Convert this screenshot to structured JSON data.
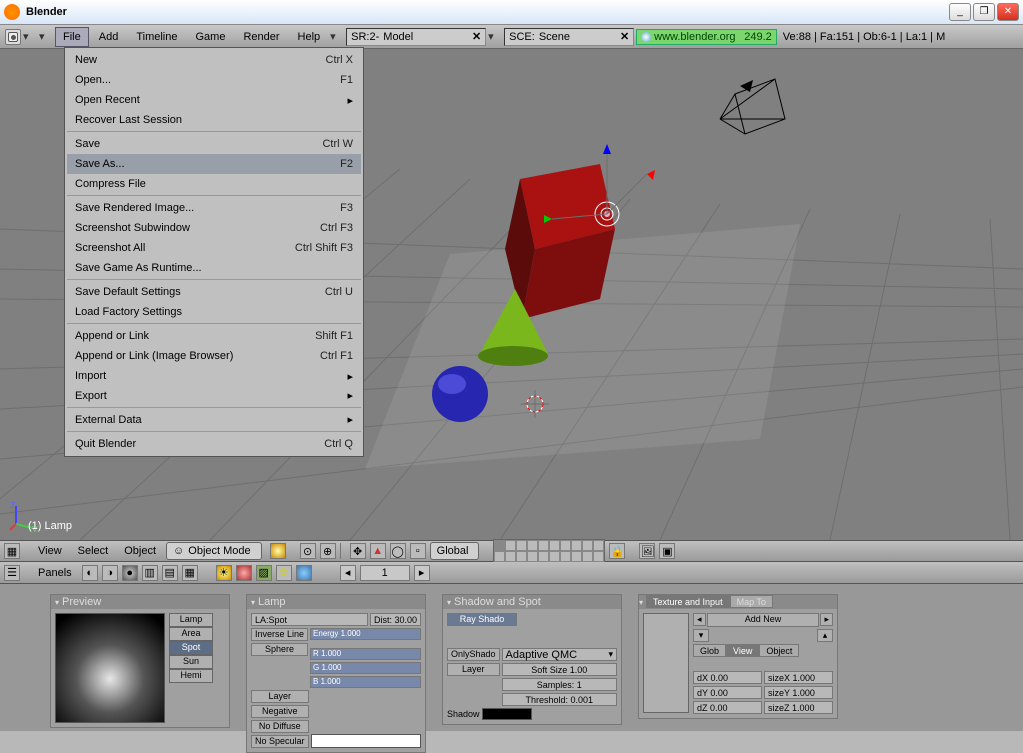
{
  "window": {
    "title": "Blender",
    "minimize": "_",
    "maximize": "❐",
    "close": "✕"
  },
  "topbar": {
    "menus": [
      "File",
      "Add",
      "Timeline",
      "Game",
      "Render",
      "Help"
    ],
    "sr_prefix": "SR:2-",
    "sr_value": "Model",
    "sce_prefix": "SCE:",
    "sce_value": "Scene",
    "url": "www.blender.org",
    "version": "249.2",
    "stats": "Ve:88 | Fa:151 | Ob:6-1 | La:1 | M"
  },
  "filemenu": [
    {
      "label": "New",
      "shortcut": "Ctrl X"
    },
    {
      "label": "Open...",
      "shortcut": "F1"
    },
    {
      "label": "Open Recent",
      "submenu": true
    },
    {
      "label": "Recover Last Session",
      "sep": true
    },
    {
      "label": "Save",
      "shortcut": "Ctrl W"
    },
    {
      "label": "Save As...",
      "shortcut": "F2",
      "hi": true
    },
    {
      "label": "Compress File",
      "sep": true
    },
    {
      "label": "Save Rendered Image...",
      "shortcut": "F3"
    },
    {
      "label": "Screenshot Subwindow",
      "shortcut": "Ctrl F3"
    },
    {
      "label": "Screenshot All",
      "shortcut": "Ctrl Shift F3"
    },
    {
      "label": "Save Game As Runtime...",
      "sep": true
    },
    {
      "label": "Save Default Settings",
      "shortcut": "Ctrl U"
    },
    {
      "label": "Load Factory Settings",
      "sep": true
    },
    {
      "label": "Append or Link",
      "shortcut": "Shift F1"
    },
    {
      "label": "Append or Link (Image Browser)",
      "shortcut": "Ctrl F1"
    },
    {
      "label": "Import",
      "submenu": true
    },
    {
      "label": "Export",
      "submenu": true,
      "sep": true
    },
    {
      "label": "External Data",
      "submenu": true,
      "sep": true
    },
    {
      "label": "Quit Blender",
      "shortcut": "Ctrl Q"
    }
  ],
  "viewport": {
    "selected": "(1) Lamp"
  },
  "header2": {
    "menus": [
      "View",
      "Select",
      "Object"
    ],
    "mode": "Object Mode",
    "orient": "Global"
  },
  "header3": {
    "label": "Panels",
    "frame": "1"
  },
  "panels": {
    "preview": {
      "title": "Preview",
      "types": [
        "Lamp",
        "Area",
        "Spot",
        "Sun",
        "Hemi"
      ],
      "active": "Spot"
    },
    "lamp": {
      "title": "Lamp",
      "la": "LA:Spot",
      "dist": "Dist: 30.00",
      "invline": "Inverse Line",
      "sphere": "Sphere",
      "energy": "Energy 1.000",
      "r": "R 1.000",
      "g": "G 1.000",
      "b": "B 1.000",
      "layer": "Layer",
      "neg": "Negative",
      "nodiff": "No Diffuse",
      "nospec": "No Specular"
    },
    "shadow": {
      "title": "Shadow and Spot",
      "ray": "Ray Shado",
      "onlysh": "OnlyShado",
      "layerb": "Layer",
      "adapt": "Adaptive QMC",
      "soft": "Soft Size 1.00",
      "samp": "Samples: 1",
      "thr": "Threshold: 0.001",
      "shadow": "Shadow"
    },
    "tex": {
      "title": "Texture and Input",
      "mapto": "Map To",
      "addnew": "Add New",
      "glob": "Glob",
      "view": "View",
      "obj": "Object",
      "dx": "dX 0.00",
      "dy": "dY 0.00",
      "dz": "dZ 0.00",
      "sx": "sizeX 1.000",
      "sy": "sizeY 1.000",
      "sz": "sizeZ 1.000"
    }
  }
}
